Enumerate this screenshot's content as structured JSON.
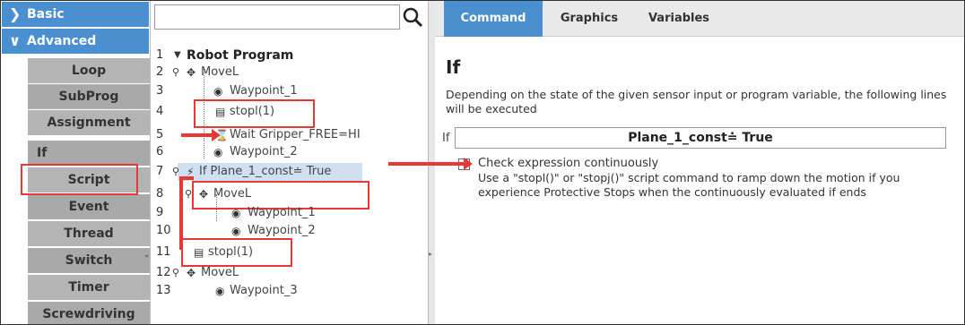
{
  "sidebar": {
    "categories": [
      {
        "label": "Basic",
        "chevron": ">"
      },
      {
        "label": "Advanced",
        "chevron": "v"
      }
    ],
    "items": [
      {
        "label": "Loop"
      },
      {
        "label": "SubProg"
      },
      {
        "label": "Assignment"
      },
      {
        "label": "If"
      },
      {
        "label": "Script"
      },
      {
        "label": "Event"
      },
      {
        "label": "Thread"
      },
      {
        "label": "Switch"
      },
      {
        "label": "Timer"
      },
      {
        "label": "Screwdriving"
      }
    ]
  },
  "tree": {
    "search_placeholder": "",
    "rows": [
      {
        "num": "1",
        "label": "Robot Program"
      },
      {
        "num": "2",
        "label": "MoveL"
      },
      {
        "num": "3",
        "label": "Waypoint_1"
      },
      {
        "num": "4",
        "label": "stopl(1)"
      },
      {
        "num": "5",
        "label": "Wait Gripper_FREE=HI"
      },
      {
        "num": "6",
        "label": "Waypoint_2"
      },
      {
        "num": "7",
        "label": "If Plane_1_const≐ True"
      },
      {
        "num": "8",
        "label": "MoveL"
      },
      {
        "num": "9",
        "label": "Waypoint_1"
      },
      {
        "num": "10",
        "label": "Waypoint_2"
      },
      {
        "num": "11",
        "label": "stopl(1)"
      },
      {
        "num": "12",
        "label": "MoveL"
      },
      {
        "num": "13",
        "label": "Waypoint_3"
      }
    ]
  },
  "tabs": [
    {
      "label": "Command"
    },
    {
      "label": "Graphics"
    },
    {
      "label": "Variables"
    }
  ],
  "content": {
    "heading": "If",
    "description": "Depending on the state of the given sensor input or program variable, the following lines will be executed",
    "if_label": "If",
    "expression": "Plane_1_const≐ True",
    "check_label": "Check expression continuously",
    "help": "Use a \"stopl()\" or \"stopj()\" script command to ramp down the motion if you experience Protective Stops when the continuously evaluated if ends"
  },
  "colors": {
    "accent": "#4a90d1",
    "highlight": "#e53935",
    "sidebar_item": "#b4b4b4"
  }
}
